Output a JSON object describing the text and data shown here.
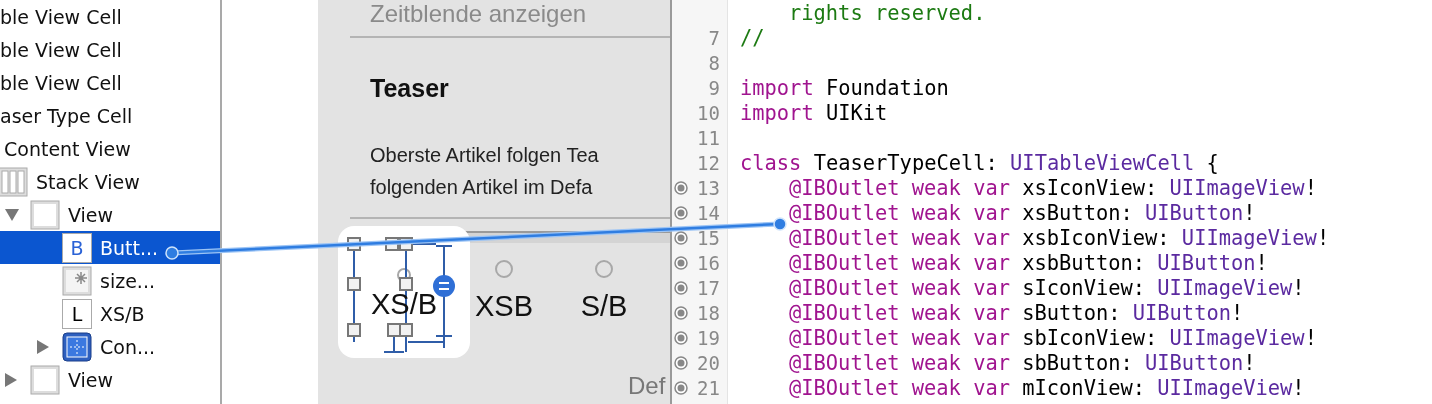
{
  "outline": [
    {
      "label": "ble View Cell",
      "selected": false
    },
    {
      "label": "ble View Cell",
      "selected": false
    },
    {
      "label": "ble View Cell",
      "selected": false
    },
    {
      "label": "aser Type Cell",
      "selected": false,
      "children": [
        {
          "label": "Content View",
          "selected": false,
          "children": [
            {
              "label": "Stack View",
              "kind": "stack",
              "selected": false,
              "children": [
                {
                  "label": "View",
                  "kind": "view",
                  "expanded": true,
                  "selected": false,
                  "children": [
                    {
                      "label": "Butt...",
                      "kind": "button",
                      "icon_text": "B",
                      "selected": true
                    },
                    {
                      "label": "size...",
                      "kind": "image",
                      "selected": false
                    },
                    {
                      "label": "XS/B",
                      "kind": "label",
                      "icon_text": "L",
                      "selected": false
                    },
                    {
                      "label": "Con...",
                      "kind": "container",
                      "expanded": false,
                      "selected": false
                    }
                  ]
                },
                {
                  "label": "View",
                  "kind": "view",
                  "expanded": false,
                  "selected": false
                }
              ]
            }
          ]
        }
      ]
    }
  ],
  "canvas": {
    "top_text": "Zeitblende anzeigen",
    "heading": "Teaser",
    "paragraph_lines": [
      "Oberste Artikel folgen Tea",
      "folgenden Artikel im Defa"
    ],
    "options": [
      {
        "label": "XS/B",
        "selected": true
      },
      {
        "label": "XSB",
        "selected": false
      },
      {
        "label": "S/B",
        "selected": false
      }
    ],
    "footer_text": "Def"
  },
  "code": [
    {
      "kind": "member",
      "tokens": [
        {
          "kind": "comment",
          "text": "rights reserved."
        }
      ]
    },
    {
      "number": "7",
      "outlet": false,
      "kind": "top",
      "tokens": [
        {
          "kind": "comment",
          "text": "//"
        }
      ]
    },
    {
      "number": "8",
      "outlet": false
    },
    {
      "number": "9",
      "outlet": false,
      "kind": "top",
      "tokens": [
        {
          "kind": "keyword",
          "text": "import"
        },
        {
          "kind": "plain",
          "text": " Foundation"
        }
      ]
    },
    {
      "number": "10",
      "outlet": false,
      "kind": "top",
      "tokens": [
        {
          "kind": "keyword",
          "text": "import"
        },
        {
          "kind": "plain",
          "text": " UIKit"
        }
      ]
    },
    {
      "number": "11",
      "outlet": false
    },
    {
      "number": "12",
      "outlet": false,
      "kind": "top",
      "tokens": [
        {
          "kind": "keyword",
          "text": "class"
        },
        {
          "kind": "plain",
          "text": " TeaserTypeCell: "
        },
        {
          "kind": "type",
          "text": "UITableViewCell"
        },
        {
          "kind": "plain",
          "text": " {"
        }
      ]
    },
    {
      "number": "13",
      "outlet": true,
      "kind": "member",
      "tokens": [
        {
          "kind": "keyword",
          "text": "@IBOutlet weak var"
        },
        {
          "kind": "plain",
          "text": " xsIconView: "
        },
        {
          "kind": "type",
          "text": "UIImageView"
        },
        {
          "kind": "plain",
          "text": "!"
        }
      ]
    },
    {
      "number": "14",
      "outlet": true,
      "kind": "member",
      "tokens": [
        {
          "kind": "keyword",
          "text": "@IBOutlet weak var"
        },
        {
          "kind": "plain",
          "text": " xsButton: "
        },
        {
          "kind": "type",
          "text": "UIButton"
        },
        {
          "kind": "plain",
          "text": "!"
        }
      ]
    },
    {
      "number": "15",
      "outlet": true,
      "kind": "member",
      "tokens": [
        {
          "kind": "keyword",
          "text": "@IBOutlet weak var"
        },
        {
          "kind": "plain",
          "text": " xsbIconView: "
        },
        {
          "kind": "type",
          "text": "UIImageView"
        },
        {
          "kind": "plain",
          "text": "!"
        }
      ]
    },
    {
      "number": "16",
      "outlet": true,
      "kind": "member",
      "tokens": [
        {
          "kind": "keyword",
          "text": "@IBOutlet weak var"
        },
        {
          "kind": "plain",
          "text": " xsbButton: "
        },
        {
          "kind": "type",
          "text": "UIButton"
        },
        {
          "kind": "plain",
          "text": "!"
        }
      ]
    },
    {
      "number": "17",
      "outlet": true,
      "kind": "member",
      "tokens": [
        {
          "kind": "keyword",
          "text": "@IBOutlet weak var"
        },
        {
          "kind": "plain",
          "text": " sIconView: "
        },
        {
          "kind": "type",
          "text": "UIImageView"
        },
        {
          "kind": "plain",
          "text": "!"
        }
      ]
    },
    {
      "number": "18",
      "outlet": true,
      "kind": "member",
      "tokens": [
        {
          "kind": "keyword",
          "text": "@IBOutlet weak var"
        },
        {
          "kind": "plain",
          "text": " sButton: "
        },
        {
          "kind": "type",
          "text": "UIButton"
        },
        {
          "kind": "plain",
          "text": "!"
        }
      ]
    },
    {
      "number": "19",
      "outlet": true,
      "kind": "member",
      "tokens": [
        {
          "kind": "keyword",
          "text": "@IBOutlet weak var"
        },
        {
          "kind": "plain",
          "text": " sbIconView: "
        },
        {
          "kind": "type",
          "text": "UIImageView"
        },
        {
          "kind": "plain",
          "text": "!"
        }
      ]
    },
    {
      "number": "20",
      "outlet": true,
      "kind": "member",
      "tokens": [
        {
          "kind": "keyword",
          "text": "@IBOutlet weak var"
        },
        {
          "kind": "plain",
          "text": " sbButton: "
        },
        {
          "kind": "type",
          "text": "UIButton"
        },
        {
          "kind": "plain",
          "text": "!"
        }
      ]
    },
    {
      "number": "21",
      "outlet": true,
      "kind": "member",
      "tokens": [
        {
          "kind": "keyword",
          "text": "@IBOutlet weak var"
        },
        {
          "kind": "plain",
          "text": " mIconView: "
        },
        {
          "kind": "type",
          "text": "UIImageView"
        },
        {
          "kind": "plain",
          "text": "!"
        }
      ]
    }
  ]
}
